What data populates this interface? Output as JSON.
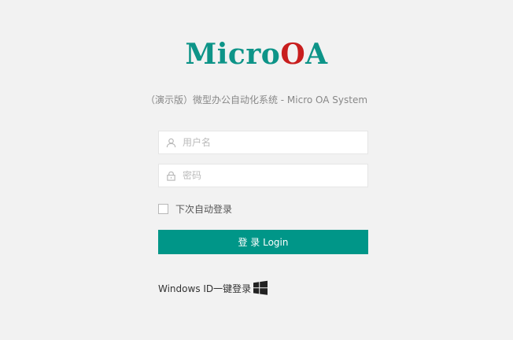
{
  "logo": {
    "part1": "Micro",
    "part2": "O",
    "part3": "A"
  },
  "subtitle": "（演示版）微型办公自动化系统 - Micro OA System",
  "form": {
    "username_placeholder": "用户名",
    "username_value": "",
    "password_placeholder": "密码",
    "password_value": "",
    "remember_label": "下次自动登录",
    "remember_checked": false,
    "login_button": "登 录 Login"
  },
  "windows_login": {
    "label": "Windows ID一键登录",
    "icon": "windows-icon"
  },
  "icons": {
    "username": "user-icon",
    "password": "lock-icon"
  },
  "colors": {
    "background": "#f2f2f2",
    "accent": "#009688",
    "logo_teal": "#0d9488",
    "logo_red": "#c81e1e"
  }
}
